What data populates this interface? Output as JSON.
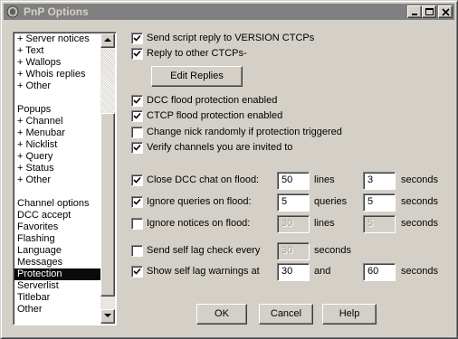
{
  "window": {
    "title": "PnP Options"
  },
  "sidebar": {
    "items": [
      {
        "label": "+ Server notices",
        "selected": false
      },
      {
        "label": "+ Text",
        "selected": false
      },
      {
        "label": "+ Wallops",
        "selected": false
      },
      {
        "label": "+ Whois replies",
        "selected": false
      },
      {
        "label": "+ Other",
        "selected": false
      },
      {
        "label": "",
        "selected": false
      },
      {
        "label": "Popups",
        "selected": false
      },
      {
        "label": "+ Channel",
        "selected": false
      },
      {
        "label": "+ Menubar",
        "selected": false
      },
      {
        "label": "+ Nicklist",
        "selected": false
      },
      {
        "label": "+ Query",
        "selected": false
      },
      {
        "label": "+ Status",
        "selected": false
      },
      {
        "label": "+ Other",
        "selected": false
      },
      {
        "label": "",
        "selected": false
      },
      {
        "label": "Channel options",
        "selected": false
      },
      {
        "label": "DCC accept",
        "selected": false
      },
      {
        "label": "Favorites",
        "selected": false
      },
      {
        "label": "Flashing",
        "selected": false
      },
      {
        "label": "Language",
        "selected": false
      },
      {
        "label": "Messages",
        "selected": false
      },
      {
        "label": "Protection",
        "selected": true
      },
      {
        "label": "Serverlist",
        "selected": false
      },
      {
        "label": "Titlebar",
        "selected": false
      },
      {
        "label": "Other",
        "selected": false
      }
    ]
  },
  "options": {
    "send_script_reply": {
      "label": "Send script reply to VERSION CTCPs",
      "checked": true
    },
    "reply_other_ctcps": {
      "label": "Reply to other CTCPs-",
      "checked": true
    },
    "edit_replies_button": "Edit Replies",
    "dcc_flood": {
      "label": "DCC flood protection enabled",
      "checked": true
    },
    "ctcp_flood": {
      "label": "CTCP flood protection enabled",
      "checked": true
    },
    "change_nick": {
      "label": "Change nick randomly if protection triggered",
      "checked": false
    },
    "verify_channels": {
      "label": "Verify channels you are invited to",
      "checked": true
    }
  },
  "flood": {
    "close_dcc": {
      "label": "Close DCC chat on flood:",
      "checked": true,
      "value1": "50",
      "unit1": "lines",
      "value2": "3",
      "unit2": "seconds"
    },
    "ignore_queries": {
      "label": "Ignore queries on flood:",
      "checked": true,
      "value1": "5",
      "unit1": "queries",
      "value2": "5",
      "unit2": "seconds"
    },
    "ignore_notices": {
      "label": "Ignore notices on flood:",
      "checked": false,
      "value1": "30",
      "unit1": "lines",
      "value2": "5",
      "unit2": "seconds"
    },
    "lag_check": {
      "label": "Send self lag check every",
      "checked": false,
      "value1": "30",
      "unit1": "seconds"
    },
    "lag_warnings": {
      "label": "Show self lag warnings at",
      "checked": true,
      "value1": "30",
      "unit1": "and",
      "value2": "60",
      "unit2": "seconds"
    }
  },
  "buttons": {
    "ok": "OK",
    "cancel": "Cancel",
    "help": "Help"
  },
  "colors": {
    "face": "#d4d0c8",
    "titlebar_inactive": "#808080",
    "selection": "#0a0a0a"
  }
}
